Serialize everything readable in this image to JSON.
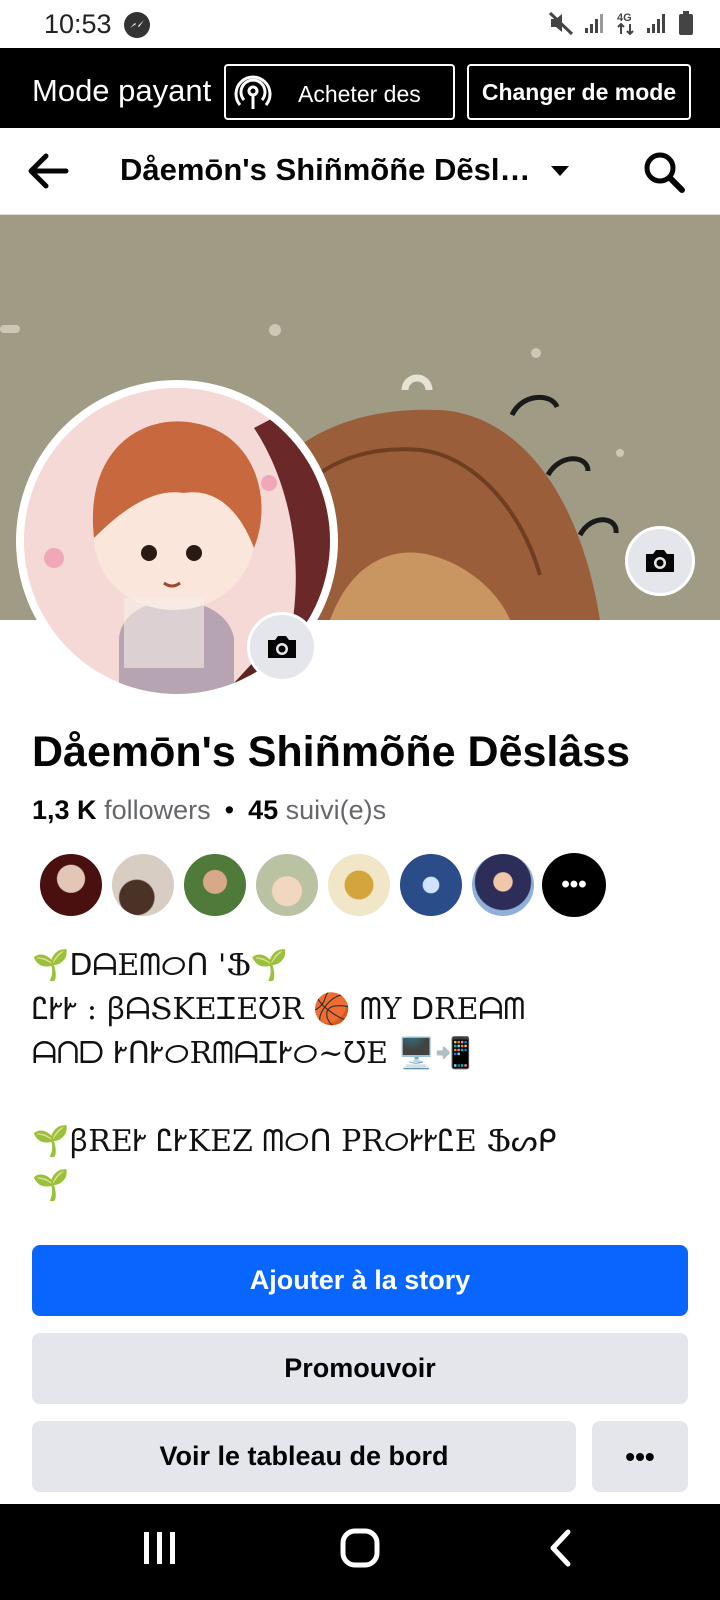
{
  "status_bar": {
    "time": "10:53",
    "icons": [
      "messenger-icon",
      "mute-icon",
      "signal-icon",
      "4g-icon",
      "signal-icon",
      "battery-icon"
    ]
  },
  "pay_bar": {
    "mode_label": "Mode payant",
    "buy_label": "Acheter des",
    "change_label": "Changer de mode"
  },
  "nav": {
    "title": "Dåemōn's Shiñmõñe Dẽslâss",
    "icons": [
      "back-arrow-icon",
      "caret-down-icon",
      "search-icon"
    ]
  },
  "profile": {
    "name": "Dåemōn's Shiñmõñe Dẽslâss",
    "followers_count": "1,3 K",
    "followers_label": "followers",
    "separator": "•",
    "following_count": "45",
    "following_label": "suivi(e)s",
    "friend_avatar_count": 8
  },
  "bio": "🌱ᗞᗩEᗰᝪᑎ 'Ֆ🌱\nᏝᎨᎨ : ꞵᗩՏKEᏆEᘮR 🏀 ᗰY ᗞREᗩᗰ\nᗩᑎᗞ ᎨᑎᎨᝪRᗰᗩᏆᎨᝪ~ᘮE 🖥️📲\n\n🌱ꞵREᎨ ᏝᎨKEZ ᗰᝪᑎ PRᝪᎨᎨᏝE Ֆᔕᑭ\n🌱",
  "actions": {
    "add_story": "Ajouter à la story",
    "promote": "Promouvoir",
    "dashboard": "Voir le tableau de bord",
    "more": "•••"
  },
  "colors": {
    "primary_button": "#0866ff",
    "secondary_button": "#e4e6eb",
    "pay_bar": "#000000",
    "cover": "#a09b84"
  }
}
